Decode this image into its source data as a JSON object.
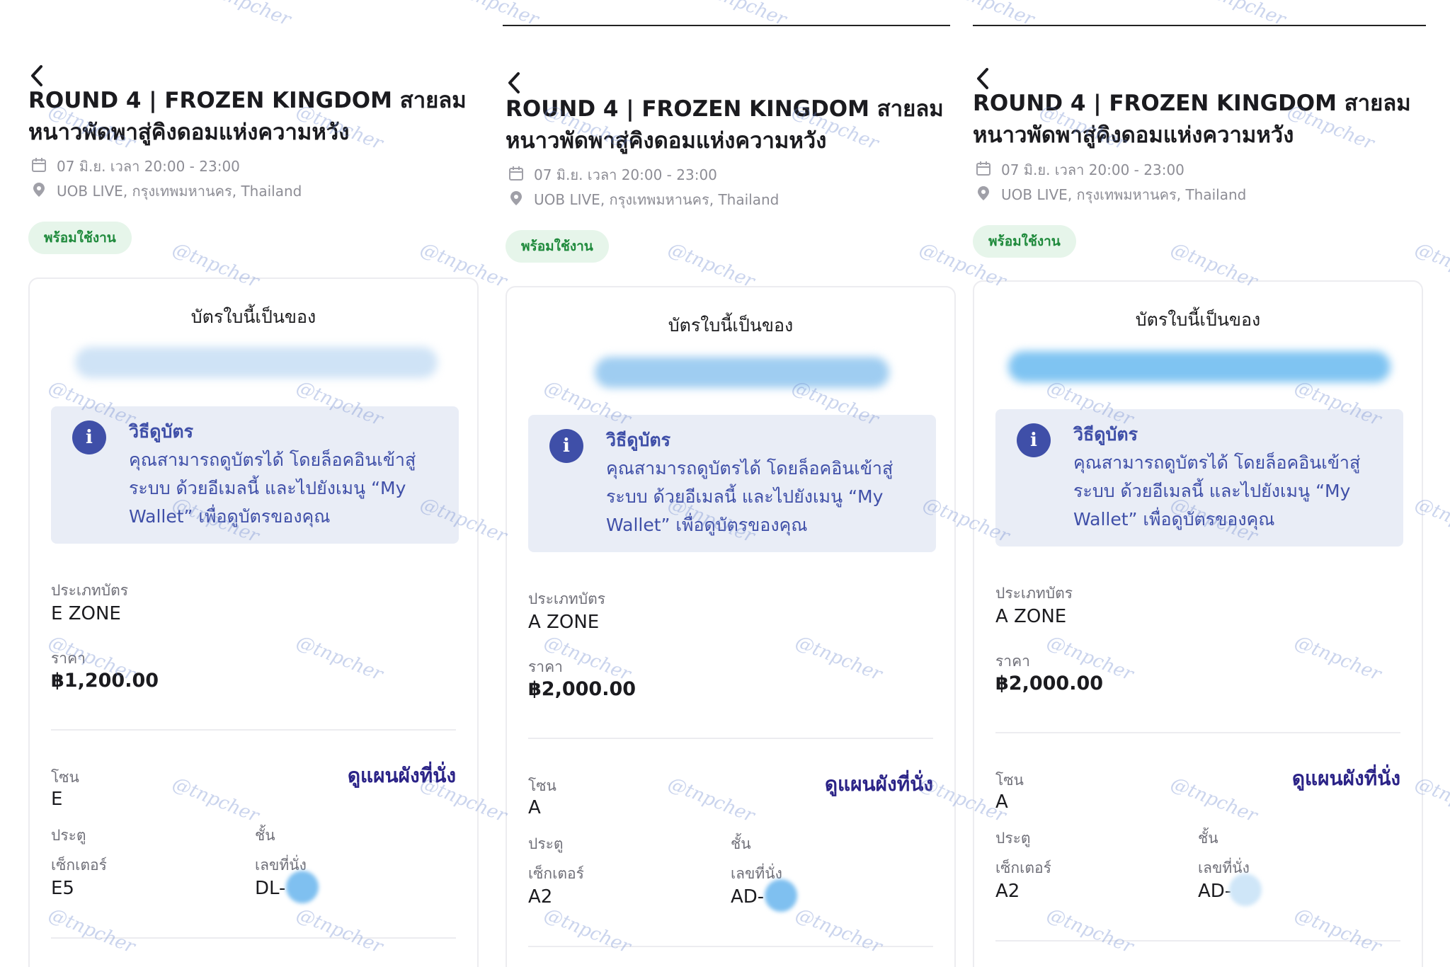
{
  "panels": [
    {
      "title": "ROUND 4 | FROZEN KINGDOM สายลมหนาวพัดพาสู่คิงดอมแห่งความหวัง",
      "date": "07 มิ.ย. เวลา 20:00 - 23:00",
      "location": "UOB LIVE, กรุงเทพมหานคร, Thailand",
      "status": "พร้อมใช้งาน",
      "owner_label": "บัตรใบนี้เป็นของ",
      "info_title": "วิธีดูบัตร",
      "info_text": "คุณสามารถดูบัตรได้ โดยล็อคอินเข้าสู่ระบบ ด้วยอีเมลนี้ และไปยังเมนู “My Wallet” เพื่อดูบัตรของคุณ",
      "ticket_type_label": "ประเภทบัตร",
      "ticket_type": "E ZONE",
      "price_label": "ราคา",
      "price": "฿1,200.00",
      "zone_label": "โซน",
      "zone": "E",
      "seat_map_link": "ดูแผนผังที่นั่ง",
      "gate_label": "ประตู",
      "floor_label": "ชั้น",
      "sector_label": "เซ็กเตอร์",
      "sector": "E5",
      "seat_label": "เลขที่นั่ง",
      "seat": "DL-"
    },
    {
      "title": "ROUND 4 | FROZEN KINGDOM สายลมหนาวพัดพาสู่คิงดอมแห่งความหวัง",
      "date": "07 มิ.ย. เวลา 20:00 - 23:00",
      "location": "UOB LIVE, กรุงเทพมหานคร, Thailand",
      "status": "พร้อมใช้งาน",
      "owner_label": "บัตรใบนี้เป็นของ",
      "info_title": "วิธีดูบัตร",
      "info_text": "คุณสามารถดูบัตรได้ โดยล็อคอินเข้าสู่ระบบ ด้วยอีเมลนี้ และไปยังเมนู “My Wallet” เพื่อดูบัตรของคุณ",
      "ticket_type_label": "ประเภทบัตร",
      "ticket_type": "A ZONE",
      "price_label": "ราคา",
      "price": "฿2,000.00",
      "zone_label": "โซน",
      "zone": "A",
      "seat_map_link": "ดูแผนผังที่นั่ง",
      "gate_label": "ประตู",
      "floor_label": "ชั้น",
      "sector_label": "เซ็กเตอร์",
      "sector": "A2",
      "seat_label": "เลขที่นั่ง",
      "seat": "AD-"
    },
    {
      "title": "ROUND 4 | FROZEN KINGDOM สายลมหนาวพัดพาสู่คิงดอมแห่งความหวัง",
      "date": "07 มิ.ย. เวลา 20:00 - 23:00",
      "location": "UOB LIVE, กรุงเทพมหานคร, Thailand",
      "status": "พร้อมใช้งาน",
      "owner_label": "บัตรใบนี้เป็นของ",
      "info_title": "วิธีดูบัตร",
      "info_text": "คุณสามารถดูบัตรได้ โดยล็อคอินเข้าสู่ระบบ ด้วยอีเมลนี้ และไปยังเมนู “My Wallet” เพื่อดูบัตรของคุณ",
      "ticket_type_label": "ประเภทบัตร",
      "ticket_type": "A ZONE",
      "price_label": "ราคา",
      "price": "฿2,000.00",
      "zone_label": "โซน",
      "zone": "A",
      "seat_map_link": "ดูแผนผังที่นั่ง",
      "gate_label": "ประตู",
      "floor_label": "ชั้น",
      "sector_label": "เซ็กเตอร์",
      "sector": "A2",
      "seat_label": "เลขที่นั่ง",
      "seat": "AD-"
    }
  ],
  "watermark": "@tnpcher",
  "colors": {
    "info_accent": "#3f4fa8",
    "info_bg": "#e9edf6",
    "status_green": "#1f8a3c",
    "status_bg": "#e6f5ea",
    "link_purple": "#2b2387",
    "redaction_blue": "#7fc0f0"
  },
  "icons": {
    "back": "chevron-left-icon",
    "date": "calendar-icon",
    "location": "location-pin-icon",
    "info": "info-icon"
  }
}
